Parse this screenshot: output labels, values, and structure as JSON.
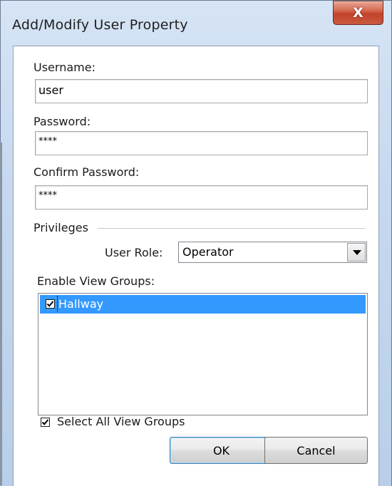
{
  "window": {
    "title": "Add/Modify User Property",
    "close_glyph": "X"
  },
  "form": {
    "username_label": "Username:",
    "username_value": "user",
    "password_label": "Password:",
    "password_value": "****",
    "confirm_label": "Confirm Password:",
    "confirm_value": "****",
    "privileges_label": "Privileges",
    "role_label": "User Role:",
    "role_value": "Operator",
    "view_groups_label": "Enable View Groups:",
    "view_groups": [
      {
        "label": "Hallway",
        "checked": true,
        "selected": true
      }
    ],
    "select_all_label": "Select All View Groups",
    "select_all_checked": true
  },
  "buttons": {
    "ok_label": "OK",
    "cancel_label": "Cancel"
  },
  "colors": {
    "selection": "#3399ff",
    "close_button": "#c4432a",
    "frame": "#c5d8ef"
  }
}
